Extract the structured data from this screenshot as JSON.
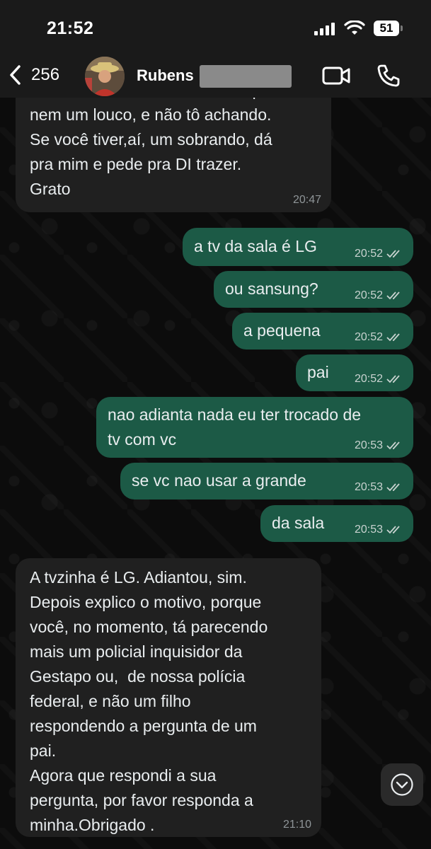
{
  "status_bar": {
    "time": "21:52",
    "battery": "51"
  },
  "header": {
    "back_count": "256",
    "contact_name": "Rubens",
    "icons": [
      "chevron-left-icon",
      "video-call-icon",
      "phone-call-icon",
      "chevron-down-icon"
    ]
  },
  "messages": [
    {
      "direction": "in",
      "text": "remoto da tvzinha,? Procurei, que\nnem um louco, e não tô achando.\nSe você tiver,aí, um sobrando, dá\npra mim e pede pra DI trazer.\nGrato",
      "time": "20:47"
    },
    {
      "direction": "out",
      "text": "a tv da sala é LG",
      "time": "20:52"
    },
    {
      "direction": "out",
      "text": "ou sansung?",
      "time": "20:52"
    },
    {
      "direction": "out",
      "text": "a pequena",
      "time": "20:52"
    },
    {
      "direction": "out",
      "text": "pai",
      "time": "20:52"
    },
    {
      "direction": "out",
      "text": "nao adianta nada eu ter trocado de\ntv com vc",
      "time": "20:53"
    },
    {
      "direction": "out",
      "text": "se vc nao usar a grande",
      "time": "20:53"
    },
    {
      "direction": "out",
      "text": "da sala",
      "time": "20:53"
    },
    {
      "direction": "in",
      "text": "A tvzinha é LG. Adiantou, sim.\nDepois explico o motivo, porque\nvocê, no momento, tá parecendo\nmais um policial inquisidor da\nGestapo ou,  de nossa polícia\nfederal, e não um filho\nrespondendo a pergunta de um\npai.\nAgora que respondi a sua\npergunta, por favor responda a\nminha.Obrigado .",
      "time": "21:10"
    }
  ],
  "colors": {
    "incoming_bubble": "#202020",
    "outgoing_bubble": "#1c5a46",
    "background": "#0b0b0b"
  }
}
